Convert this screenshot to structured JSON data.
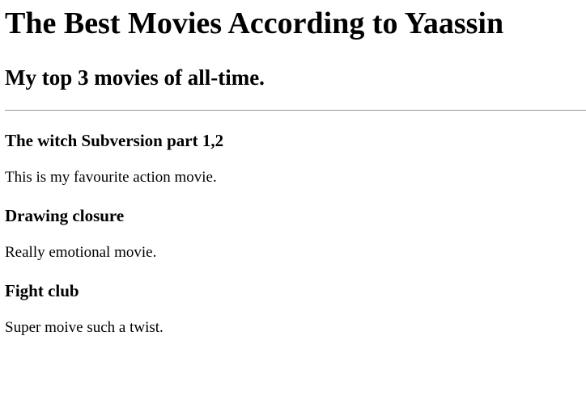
{
  "page": {
    "title": "The Best Movies According to Yaassin",
    "subtitle": "My top 3 movies of all-time."
  },
  "movies": [
    {
      "title": "The witch Subversion part 1,2",
      "description": "This is my favourite action movie."
    },
    {
      "title": "Drawing closure",
      "description": "Really emotional movie."
    },
    {
      "title": "Fight club",
      "description": "Super moive such a twist."
    }
  ]
}
